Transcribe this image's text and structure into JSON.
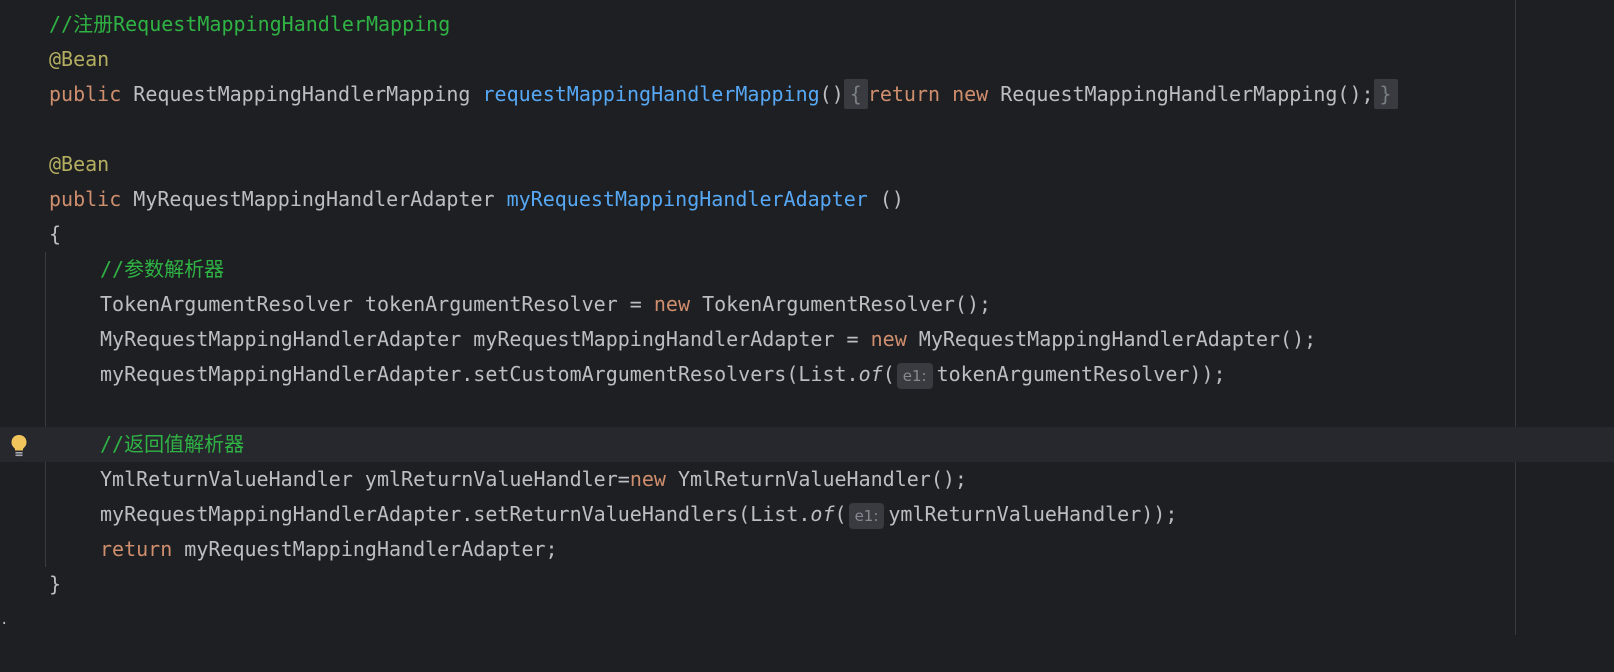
{
  "lines": [
    {
      "comment": "//注册RequestMappingHandlerMapping"
    },
    {
      "annotation": "@Bean"
    },
    {
      "kw_public": "public",
      "type": "RequestMappingHandlerMapping",
      "method": "requestMappingHandlerMapping",
      "parens": "()",
      "fold_open": "{",
      "kw_return": "return",
      "kw_new": "new",
      "ctor": "RequestMappingHandlerMapping();",
      "fold_close": "}"
    },
    {},
    {
      "annotation": "@Bean"
    },
    {
      "kw_public": "public",
      "type": "MyRequestMappingHandlerAdapter",
      "method": "myRequestMappingHandlerAdapter",
      "parens": "()"
    },
    {
      "brace": "{"
    },
    {
      "comment": "//参数解析器"
    },
    {
      "left": "TokenArgumentResolver tokenArgumentResolver = ",
      "kw_new": "new",
      "right": "TokenArgumentResolver();"
    },
    {
      "left": "MyRequestMappingHandlerAdapter myRequestMappingHandlerAdapter = ",
      "kw_new": "new",
      "right": "MyRequestMappingHandlerAdapter();"
    },
    {
      "left": "myRequestMappingHandlerAdapter.setCustomArgumentResolvers(List.",
      "italic": "of",
      "paren": "(",
      "hint": "e1:",
      "right": "tokenArgumentResolver));"
    },
    {},
    {
      "comment": "//返回值解析器"
    },
    {
      "left": "YmlReturnValueHandler ymlReturnValueHandler=",
      "kw_new": "new",
      "right": "YmlReturnValueHandler();"
    },
    {
      "left": "myRequestMappingHandlerAdapter.setReturnValueHandlers(List.",
      "italic": "of",
      "paren": "(",
      "hint": "e1:",
      "right": "ymlReturnValueHandler));"
    },
    {
      "kw_return": "return",
      "right": "myRequestMappingHandlerAdapter;"
    },
    {
      "brace": "}"
    }
  ],
  "gutter": {
    "intention_icon": "lightbulb-icon",
    "bulb_color": "#f2c55c"
  },
  "colors": {
    "background": "#1e1f22",
    "comment": "#2fb344",
    "annotation": "#b3ae60",
    "keyword": "#cf8e6d",
    "method": "#56a8f5",
    "text": "#bcbec4"
  }
}
